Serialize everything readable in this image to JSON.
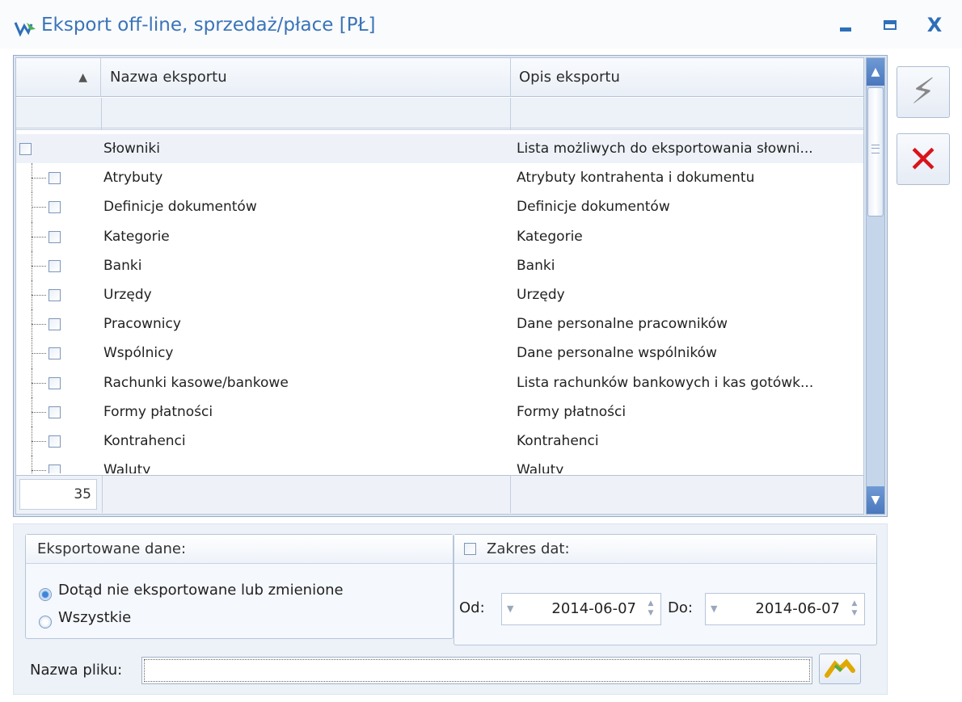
{
  "window": {
    "title": "Eksport off-line, sprzedaż/płace [PŁ]",
    "icon": "export-app-icon",
    "minimize_glyph": "–",
    "close_glyph": "X"
  },
  "grid": {
    "sort_indicator": "▲",
    "columns": [
      "Nazwa eksportu",
      "Opis eksportu"
    ],
    "rows": [
      {
        "name": "Słowniki",
        "description": "Lista możliwych do eksportowania słowni...",
        "checked": false,
        "level": 0
      },
      {
        "name": "Atrybuty",
        "description": "Atrybuty kontrahenta i dokumentu",
        "checked": false,
        "level": 1
      },
      {
        "name": "Definicje dokumentów",
        "description": "Definicje dokumentów",
        "checked": false,
        "level": 1
      },
      {
        "name": "Kategorie",
        "description": "Kategorie",
        "checked": false,
        "level": 1
      },
      {
        "name": "Banki",
        "description": "Banki",
        "checked": false,
        "level": 1
      },
      {
        "name": "Urzędy",
        "description": "Urzędy",
        "checked": false,
        "level": 1
      },
      {
        "name": "Pracownicy",
        "description": "Dane personalne pracowników",
        "checked": false,
        "level": 1
      },
      {
        "name": "Wspólnicy",
        "description": "Dane personalne wspólników",
        "checked": false,
        "level": 1
      },
      {
        "name": "Rachunki kasowe/bankowe",
        "description": "Lista rachunków bankowych i kas gotówk...",
        "checked": false,
        "level": 1
      },
      {
        "name": "Formy płatności",
        "description": "Formy płatności",
        "checked": false,
        "level": 1
      },
      {
        "name": "Kontrahenci",
        "description": "Kontrahenci",
        "checked": false,
        "level": 1
      },
      {
        "name": "Waluty",
        "description": "Waluty",
        "checked": false,
        "level": 1
      }
    ],
    "row_count": "35"
  },
  "side_buttons": {
    "run": "⚡",
    "cancel": "✕"
  },
  "exported_data": {
    "title": "Eksportowane dane:",
    "options": [
      "Dotąd nie eksportowane lub zmienione",
      "Wszystkie"
    ],
    "selected": "Dotąd nie eksportowane lub zmienione"
  },
  "date_range": {
    "title": "Zakres dat:",
    "enabled": false,
    "from_label": "Od:",
    "from_value": "2014-06-07",
    "to_label": "Do:",
    "to_value": "2014-06-07"
  },
  "file": {
    "label": "Nazwa pliku:",
    "value": ""
  },
  "colors": {
    "accent": "#3a74b8",
    "cancel_red": "#d8141b",
    "scroll_blue": "#4a78bd"
  }
}
